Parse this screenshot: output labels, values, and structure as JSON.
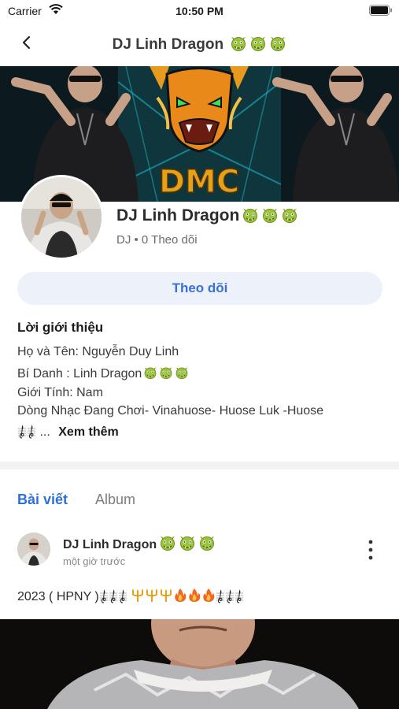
{
  "status_bar": {
    "carrier": "Carrier",
    "time": "10:50 PM"
  },
  "nav": {
    "title": "DJ Linh Dragon",
    "title_emoji_count": 3,
    "emoji_icon": "dragon-face-icon"
  },
  "banner": {
    "logo_text": "DMC"
  },
  "profile": {
    "name": "DJ Linh Dragon",
    "meta": "DJ • 0 Theo dõi",
    "follow_label": "Theo dõi"
  },
  "intro": {
    "title": "Lời giới thiệu",
    "lines": [
      "Họ và Tên: Nguyễn Duy Linh",
      "Bí Danh : Linh Dragon",
      "Giới Tính: Nam",
      "Dòng Nhạc Đang Chơi- Vinahuose- Huose Luk -Huose"
    ],
    "line5_suffix": "...",
    "see_more": "Xem thêm"
  },
  "tabs": [
    {
      "label": "Bài viết",
      "active": true
    },
    {
      "label": "Album",
      "active": false
    }
  ],
  "post": {
    "author": "DJ Linh Dragon",
    "time": "một giờ trước",
    "text_prefix": "2023 ( HPNY )"
  },
  "colors": {
    "accent": "#2f6fd8",
    "follow_bg": "#edf2fa",
    "emoji_green": "#9cc43a",
    "fire": "#f26522",
    "trident": "#e6a11a"
  }
}
